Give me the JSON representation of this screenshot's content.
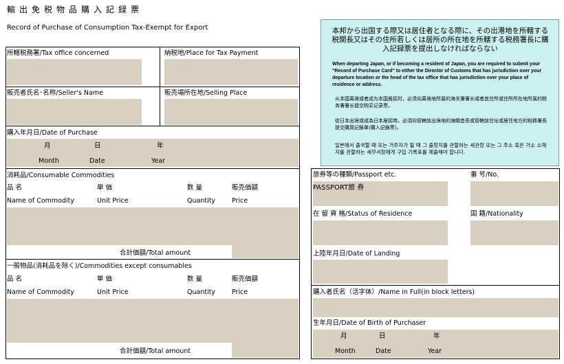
{
  "header": {
    "title_jp": "輸出免税物品購入記録票",
    "title_en": "Record of Purchase of Consumption Tax-Exempt for Export"
  },
  "notice": {
    "jp": "本邦から出国する際又は居住者となる際に、その出港地を所轄する税関長又はその住所若しくは居所の所在地を所轄する税務署長に購入記録票を提出しなければならない",
    "en": "When departing Japan, or if becoming a resident of Japan, you are required to submit your \"Record of Purchase Card\" to either the Director of Customs that has jurisdiction over your departure location or the head of the tax office that has jurisdiction over your place of residence or address.",
    "cn_simplified": "从本国离境或者成为本国居民时，必须向离境地所属的海关署署长或者其住所或住所所在地所属的税务署署长提交购买记录票。",
    "cn_traditional": "從日本出境或成為日本居民時，必須向管轄該出境地的海關首長或管轄該住址或居住地方的稅務署長提交購買記錄單(購入記錄票)。",
    "ko": "일본에서 출국할 때 또는 거주자가 될 때 그 출항지를 관할하는 세관장 또는 그 주소 혹은 거소 소재지를 관할하는 세무서장에게 구입 기록표를 제출해야 합니다."
  },
  "left": {
    "tax_office": "所轄税務署/Tax office concerned",
    "payment_place": "納税地/Place for Tax Payment",
    "seller_name": "販売者氏名･名称/Seller's Name",
    "selling_place": "販売場所在地/Selling Place",
    "purchase_date": "購入年月日/Date of Purchase",
    "month_jp": "月",
    "date_jp": "日",
    "year_jp": "年",
    "month_en": "Month",
    "date_en": "Date",
    "year_en": "Year",
    "consumable": {
      "heading": "消耗品/Consumable Commodities",
      "col_jp": [
        "品 名",
        "単 価",
        "数 量",
        "販売価額"
      ],
      "col_en": [
        "Name of Commodity",
        "Unit Price",
        "Quantity",
        "Price"
      ],
      "total": "合計価額/Total amount"
    },
    "general": {
      "heading": "一般物品(消耗品を除く)/Commodities except  consumables",
      "col_jp": [
        "品 名",
        "単 価",
        "数 量",
        "販売価額"
      ],
      "col_en": [
        "Name of Commodity",
        "Unit Price",
        "Quantity",
        "Price"
      ],
      "total": "合計価額/Total amount"
    }
  },
  "right": {
    "passport_type": "旅券等の種類/Passport etc.",
    "passport_no": "番 号/No.",
    "passport_value": "PASSPORT旅 券",
    "status": "在 留 資 格/Status of Residence",
    "nationality": "国 籍/Nationality",
    "landing": "上陸年月日/Date of Landing",
    "name": "購入者氏名（活字体）/Name in Full(in block letters)",
    "birth": "生年月日/Date of Birth of Purchaser",
    "month_jp": "月",
    "date_jp": "日",
    "year_jp": "年",
    "month_en": "Month",
    "date_en": "Date",
    "year_en": "Year"
  }
}
